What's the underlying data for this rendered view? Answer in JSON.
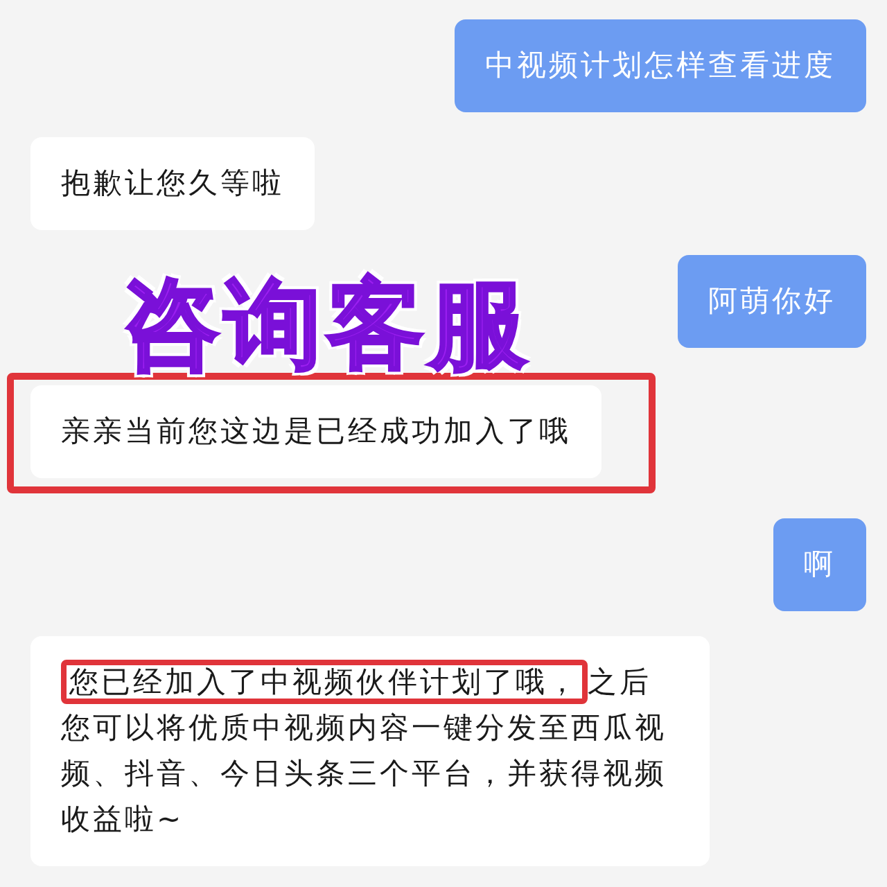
{
  "annotation": {
    "text": "咨询客服"
  },
  "messages": [
    {
      "kind": "sent",
      "framed": false,
      "parts": [
        {
          "text": "中视频计划怎样查看进度",
          "highlighted": false
        }
      ]
    },
    {
      "kind": "received",
      "framed": false,
      "parts": [
        {
          "text": "抱歉让您久等啦",
          "highlighted": false
        }
      ]
    },
    {
      "kind": "sent",
      "framed": false,
      "parts": [
        {
          "text": "阿萌你好",
          "highlighted": false
        }
      ]
    },
    {
      "kind": "received",
      "framed": true,
      "parts": [
        {
          "text": "亲亲当前您这边是已经成功加入了哦",
          "highlighted": false
        }
      ]
    },
    {
      "kind": "sent",
      "framed": false,
      "parts": [
        {
          "text": "啊",
          "highlighted": false
        }
      ]
    },
    {
      "kind": "received",
      "framed": false,
      "parts": [
        {
          "text": "您已经加入了中视频伙伴计划了哦，",
          "highlighted": true
        },
        {
          "text": "之后您可以将优质中视频内容一键分发至西瓜视频、抖音、今日头条三个平台，并获得视频收益啦~",
          "highlighted": false
        }
      ]
    }
  ]
}
